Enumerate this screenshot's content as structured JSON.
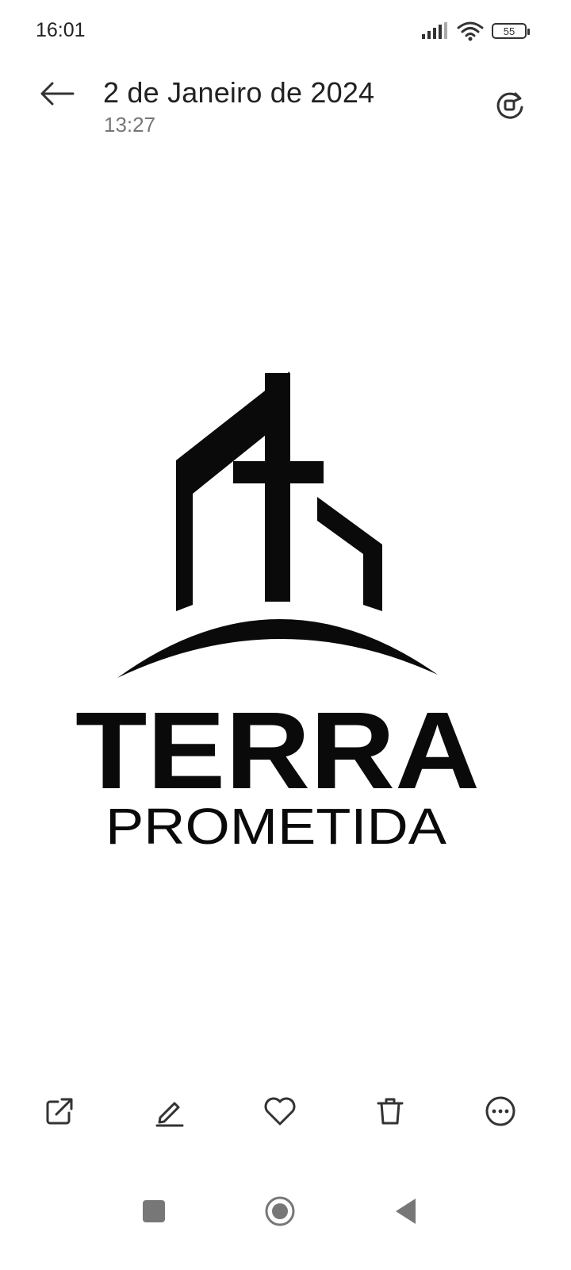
{
  "status_bar": {
    "time": "16:01",
    "battery_level": "55",
    "icons": [
      "signal-icon",
      "wifi-icon",
      "battery-icon"
    ]
  },
  "header": {
    "title": "2 de Janeiro de 2024",
    "subtitle": "13:27",
    "back_icon": "arrow-left-icon",
    "action_icon": "rotate-icon"
  },
  "photo": {
    "logo_line1": "TERRA",
    "logo_line2": "PROMETIDA"
  },
  "toolbar": {
    "icons": [
      "share-icon",
      "edit-icon",
      "favorite-icon",
      "delete-icon",
      "more-icon"
    ]
  },
  "navbar": {
    "icons": [
      "recents-icon",
      "home-icon",
      "back-nav-icon"
    ]
  },
  "colors": {
    "background": "#ffffff",
    "text_primary": "#222222",
    "text_secondary": "#777777",
    "logo": "#0a0a0a"
  }
}
